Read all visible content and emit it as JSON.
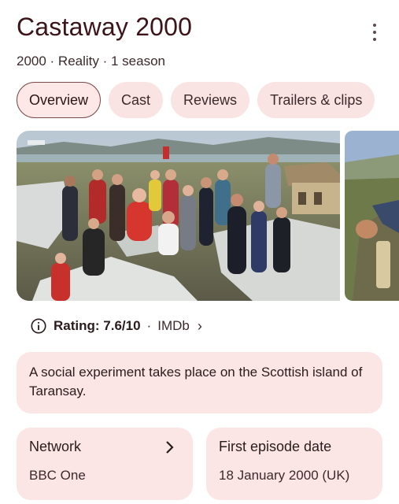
{
  "header": {
    "title": "Castaway 2000",
    "subtitle": "2000 · Reality · 1 season",
    "more_icon": "more-vert-icon"
  },
  "tabs": [
    {
      "label": "Overview",
      "active": true
    },
    {
      "label": "Cast",
      "active": false
    },
    {
      "label": "Reviews",
      "active": false
    },
    {
      "label": "Trailers & clips",
      "active": false
    }
  ],
  "rating": {
    "label": "Rating: 7.6/10",
    "separator": "·",
    "source": "IMDb",
    "chevron": "›"
  },
  "description": "A social experiment takes place on the Scottish island of Taransay.",
  "cards": [
    {
      "label": "Network",
      "value": "BBC One",
      "has_chevron": true
    },
    {
      "label": "First episode date",
      "value": "18 January 2000 (UK)",
      "has_chevron": false
    }
  ],
  "colors": {
    "accent_bg": "#fbe6e5",
    "title": "#3c1419",
    "active_chip_border": "#7a4a4d"
  }
}
